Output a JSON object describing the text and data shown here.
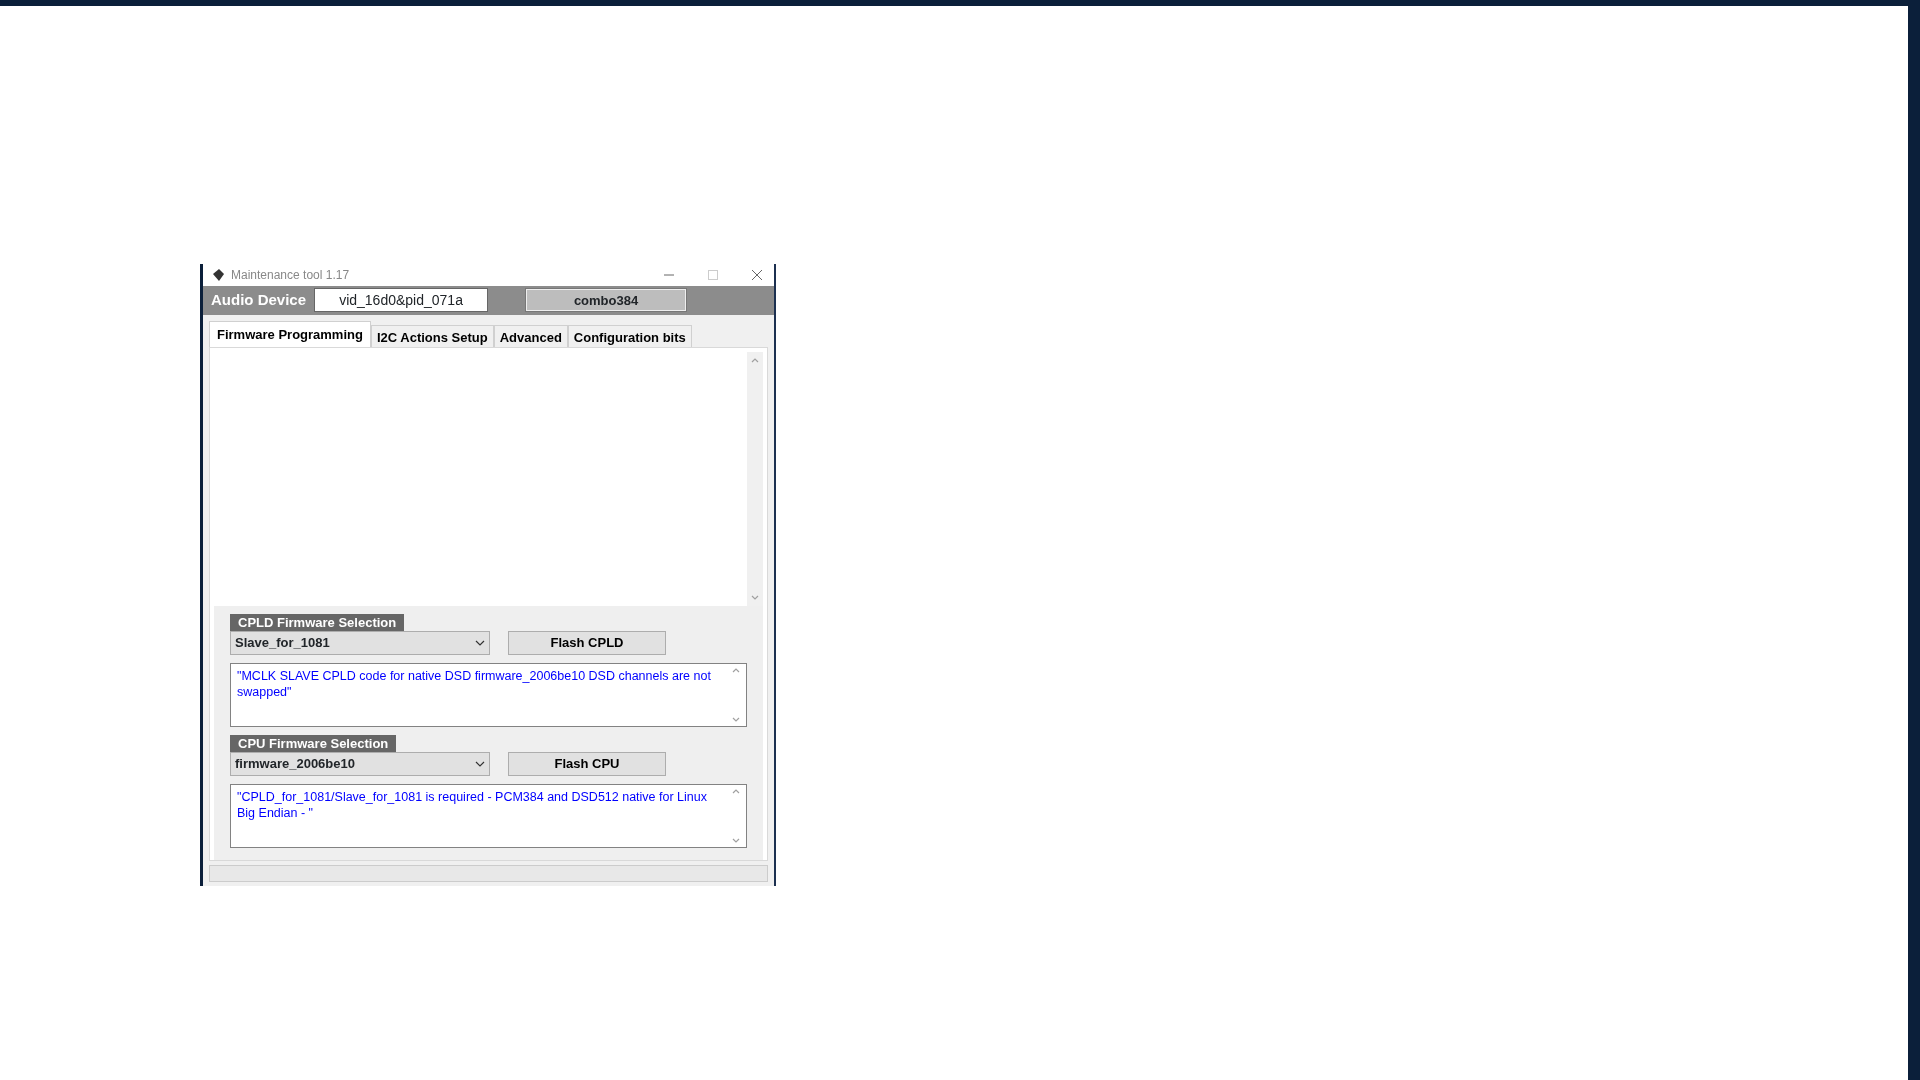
{
  "window": {
    "title": "Maintenance tool 1.17"
  },
  "header": {
    "label": "Audio Device",
    "device_id": "vid_16d0&pid_071a",
    "device_name": "combo384"
  },
  "tabs": [
    {
      "label": "Firmware Programming",
      "selected": true
    },
    {
      "label": "I2C Actions Setup",
      "selected": false
    },
    {
      "label": "Advanced",
      "selected": false
    },
    {
      "label": "Configuration bits",
      "selected": false
    }
  ],
  "sections": [
    {
      "title": "CPLD Firmware Selection",
      "selection": "Slave_for_1081",
      "button": "Flash CPLD",
      "description": "\"MCLK SLAVE CPLD code for native DSD firmware_2006be10 DSD channels are not swapped\""
    },
    {
      "title": "CPU Firmware Selection",
      "selection": "firmware_2006be10",
      "button": "Flash CPU",
      "description": "\"CPLD_for_1081/Slave_for_1081 is required - PCM384 and DSD512 native for Linux Big Endian - \""
    }
  ]
}
